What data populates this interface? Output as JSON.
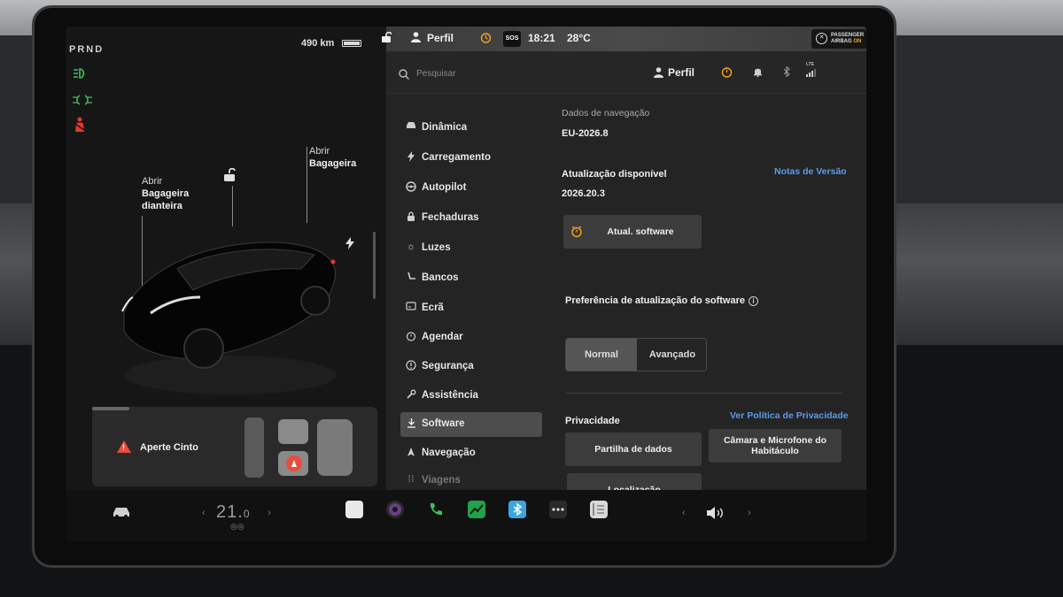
{
  "vehicle": {
    "gear": "PRND",
    "range": "490 km",
    "front_trunk": {
      "line1": "Abrir",
      "line2": "Bagageira",
      "line3": "dianteira"
    },
    "rear_trunk": {
      "line1": "Abrir",
      "line2": "Bagageira"
    },
    "alert_text": "Aperte Cinto"
  },
  "status_bar": {
    "profile": "Perfil",
    "sos": "SOS",
    "time": "18:21",
    "temperature": "28°C",
    "airbag_line1": "PASSENGER",
    "airbag_line2": "AIRBAG",
    "airbag_state": "ON"
  },
  "header": {
    "search_placeholder": "Pesquisar",
    "profile": "Perfil",
    "network": "LTE"
  },
  "menu": {
    "items": [
      {
        "label": "Dinâmica",
        "icon": "car-icon"
      },
      {
        "label": "Carregamento",
        "icon": "bolt-icon"
      },
      {
        "label": "Autopilot",
        "icon": "steering-wheel-icon"
      },
      {
        "label": "Fechaduras",
        "icon": "lock-icon"
      },
      {
        "label": "Luzes",
        "icon": "sun-icon"
      },
      {
        "label": "Bancos",
        "icon": "seat-icon"
      },
      {
        "label": "Ecrã",
        "icon": "display-icon"
      },
      {
        "label": "Agendar",
        "icon": "alarm-icon"
      },
      {
        "label": "Segurança",
        "icon": "info-circle-icon"
      },
      {
        "label": "Assistência",
        "icon": "wrench-icon"
      },
      {
        "label": "Software",
        "icon": "download-icon"
      },
      {
        "label": "Navegação",
        "icon": "navigation-icon"
      },
      {
        "label": "Viagens",
        "icon": "trips-icon"
      }
    ]
  },
  "software": {
    "nav_data_label": "Dados de navegação",
    "nav_data_value": "EU-2026.8",
    "update_available_label": "Atualização disponível",
    "update_version": "2026.20.3",
    "release_notes_link": "Notas de Versão",
    "update_button": "Atual. software",
    "preference_label": "Preferência de atualização do software",
    "preference_options": [
      "Normal",
      "Avançado"
    ],
    "preference_selected": "Normal",
    "privacy_label": "Privacidade",
    "privacy_link": "Ver Política de Privacidade",
    "data_sharing_button": "Partilha de dados",
    "camera_mic_button_line1": "Câmara e Microfone do",
    "camera_mic_button_line2": "Habitáculo",
    "location_button": "Localização"
  },
  "dock": {
    "temp_value": "21.",
    "temp_decimal": "0"
  },
  "colors": {
    "accent_link": "#5b9bea",
    "indicator_green": "#3cc35a",
    "warning_red": "#e84d3d",
    "alarm_orange": "#f5a623"
  }
}
